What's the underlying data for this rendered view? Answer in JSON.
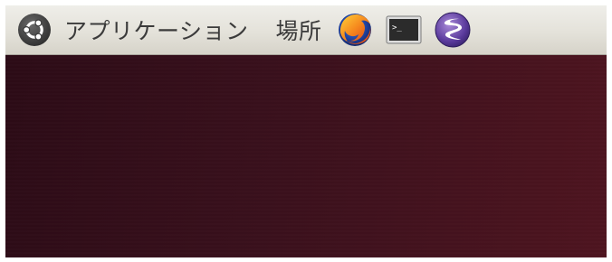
{
  "panel": {
    "menu_applications": "アプリケーション",
    "menu_places": "場所",
    "launchers": [
      {
        "icon": "firefox-icon"
      },
      {
        "icon": "terminal-icon"
      },
      {
        "icon": "emacs-icon"
      }
    ]
  },
  "colors": {
    "panel_top": "#efeee9",
    "panel_bottom": "#d6d3c9",
    "desktop_left": "#2c0b16",
    "desktop_right": "#4e141f",
    "menu_text": "#3b3b3b"
  }
}
